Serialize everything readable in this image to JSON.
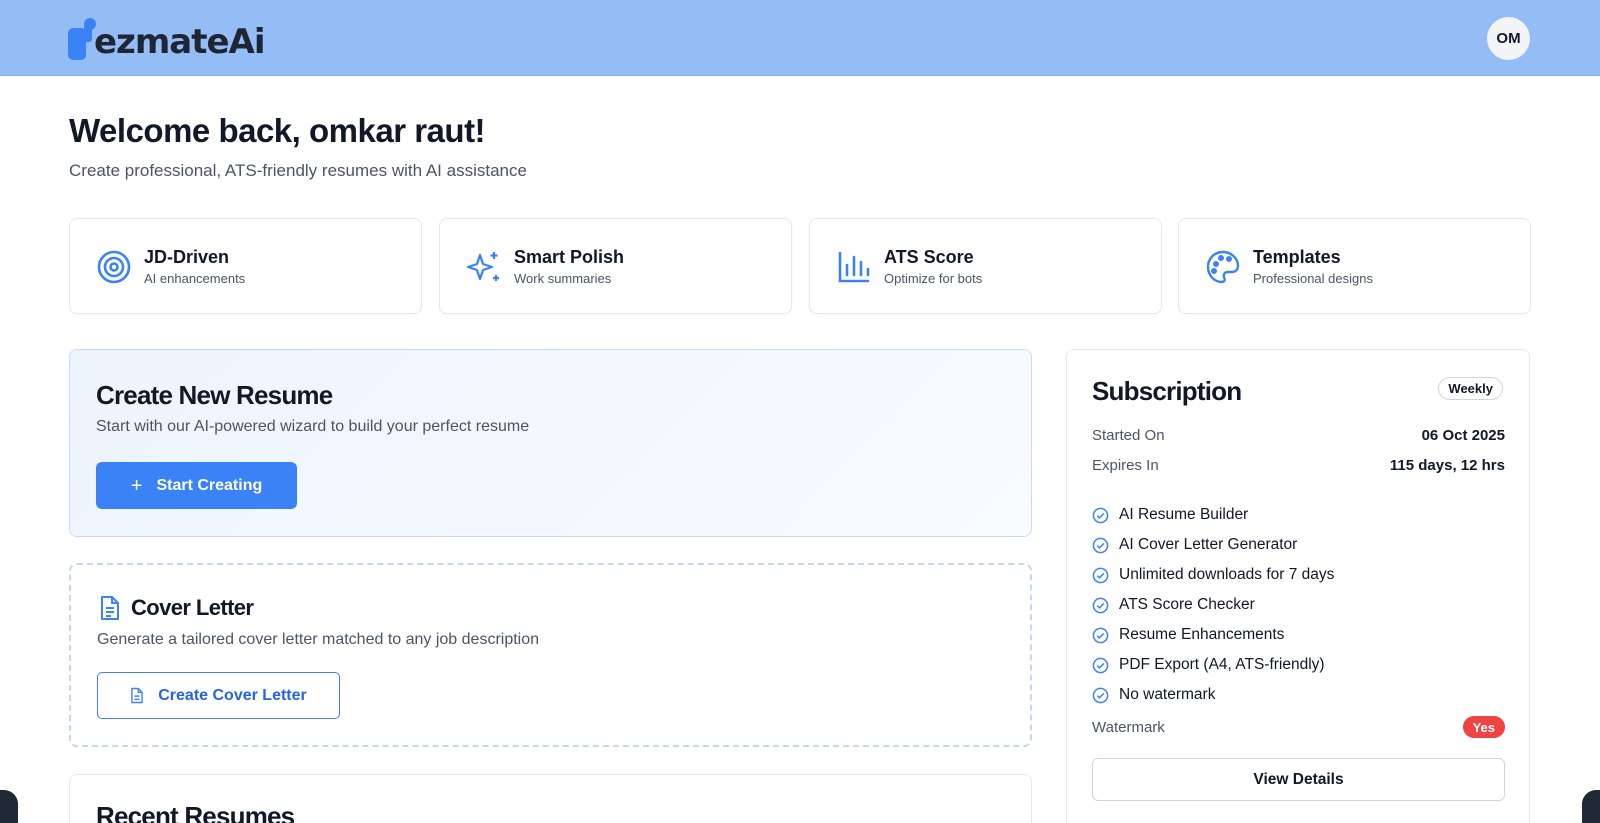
{
  "header": {
    "logo_text": "ezmateAi",
    "avatar_initials": "OM",
    "brand_color": "#94bdf5"
  },
  "welcome": {
    "title": "Welcome back, omkar raut!",
    "subtitle": "Create professional, ATS-friendly resumes with AI assistance"
  },
  "features": [
    {
      "icon": "target-icon",
      "title": "JD-Driven",
      "subtitle": "AI enhancements"
    },
    {
      "icon": "sparkles-icon",
      "title": "Smart Polish",
      "subtitle": "Work summaries"
    },
    {
      "icon": "bar-chart-icon",
      "title": "ATS Score",
      "subtitle": "Optimize for bots"
    },
    {
      "icon": "palette-icon",
      "title": "Templates",
      "subtitle": "Professional designs"
    }
  ],
  "create_resume": {
    "title": "Create New Resume",
    "subtitle": "Start with our AI-powered wizard to build your perfect resume",
    "button_label": "Start Creating",
    "button_icon": "plus-icon"
  },
  "cover_letter": {
    "title": "Cover Letter",
    "subtitle": "Generate a tailored cover letter matched to any job description",
    "button_label": "Create Cover Letter",
    "button_icon": "document-icon"
  },
  "recent": {
    "title": "Recent Resumes"
  },
  "subscription": {
    "title": "Subscription",
    "plan": "Weekly",
    "started_label": "Started On",
    "started_value": "06 Oct 2025",
    "expires_label": "Expires In",
    "expires_value": "115 days, 12 hrs",
    "features": [
      "AI Resume Builder",
      "AI Cover Letter Generator",
      "Unlimited downloads for 7 days",
      "ATS Score Checker",
      "Resume Enhancements",
      "PDF Export (A4, ATS-friendly)",
      "No watermark"
    ],
    "watermark_label": "Watermark",
    "watermark_value": "Yes",
    "details_button": "View Details"
  },
  "colors": {
    "accent": "#3b82f6",
    "danger": "#ef4444"
  }
}
